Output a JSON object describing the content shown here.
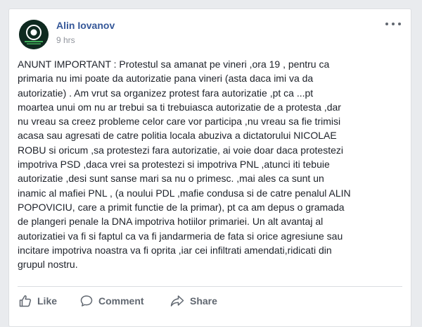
{
  "post": {
    "author": "Alin Iovanov",
    "time": "9 hrs",
    "lines": [
      "ANUNT IMPORTANT : Protestul sa amanat pe vineri ,ora 19 , pentru ca",
      "primaria nu imi poate da autorizatie pana vineri (asta daca imi va da",
      "autorizatie) . Am vrut sa organizez protest fara autorizatie ,pt ca ...pt",
      "moartea unui om nu ar trebui sa ti trebuiasca autorizatie de a protesta ,dar",
      "nu vreau sa creez probleme celor care vor participa ,nu vreau sa fie trimisi",
      "acasa sau agresati de catre politia locala abuziva a dictatorului NICOLAE",
      "ROBU si oricum ,sa protestezi fara autorizatie, ai voie doar daca protestezi",
      "impotriva PSD ,daca vrei sa protestezi si impotriva PNL ,atunci iti tebuie",
      "autorizatie ,desi sunt sanse mari sa nu o primesc. ,mai ales ca sunt un",
      "inamic al mafiei PNL , (a noului PDL ,mafie condusa si de catre penalul ALIN",
      "POPOVICIU, care a primit functie de la primar), pt ca am depus o gramada",
      "de plangeri penale la DNA impotriva hotiilor primariei. Un alt avantaj al",
      "autorizatiei va fi si faptul ca va fi jandarmeria de fata si orice agresiune sau",
      "incitare impotriva noastra va fi oprita ,iar cei infiltrati amendati,ridicati din",
      "grupul nostru."
    ]
  },
  "actions": {
    "like": "Like",
    "comment": "Comment",
    "share": "Share"
  },
  "icons": {
    "avatar": "avatar-logo-icon",
    "menu": "more-options-icon",
    "like": "thumbs-up-icon",
    "comment": "speech-bubble-icon",
    "share": "share-arrow-icon"
  },
  "colors": {
    "author": "#365899",
    "text": "#1d2129",
    "muted": "#90949c",
    "action": "#606770"
  }
}
